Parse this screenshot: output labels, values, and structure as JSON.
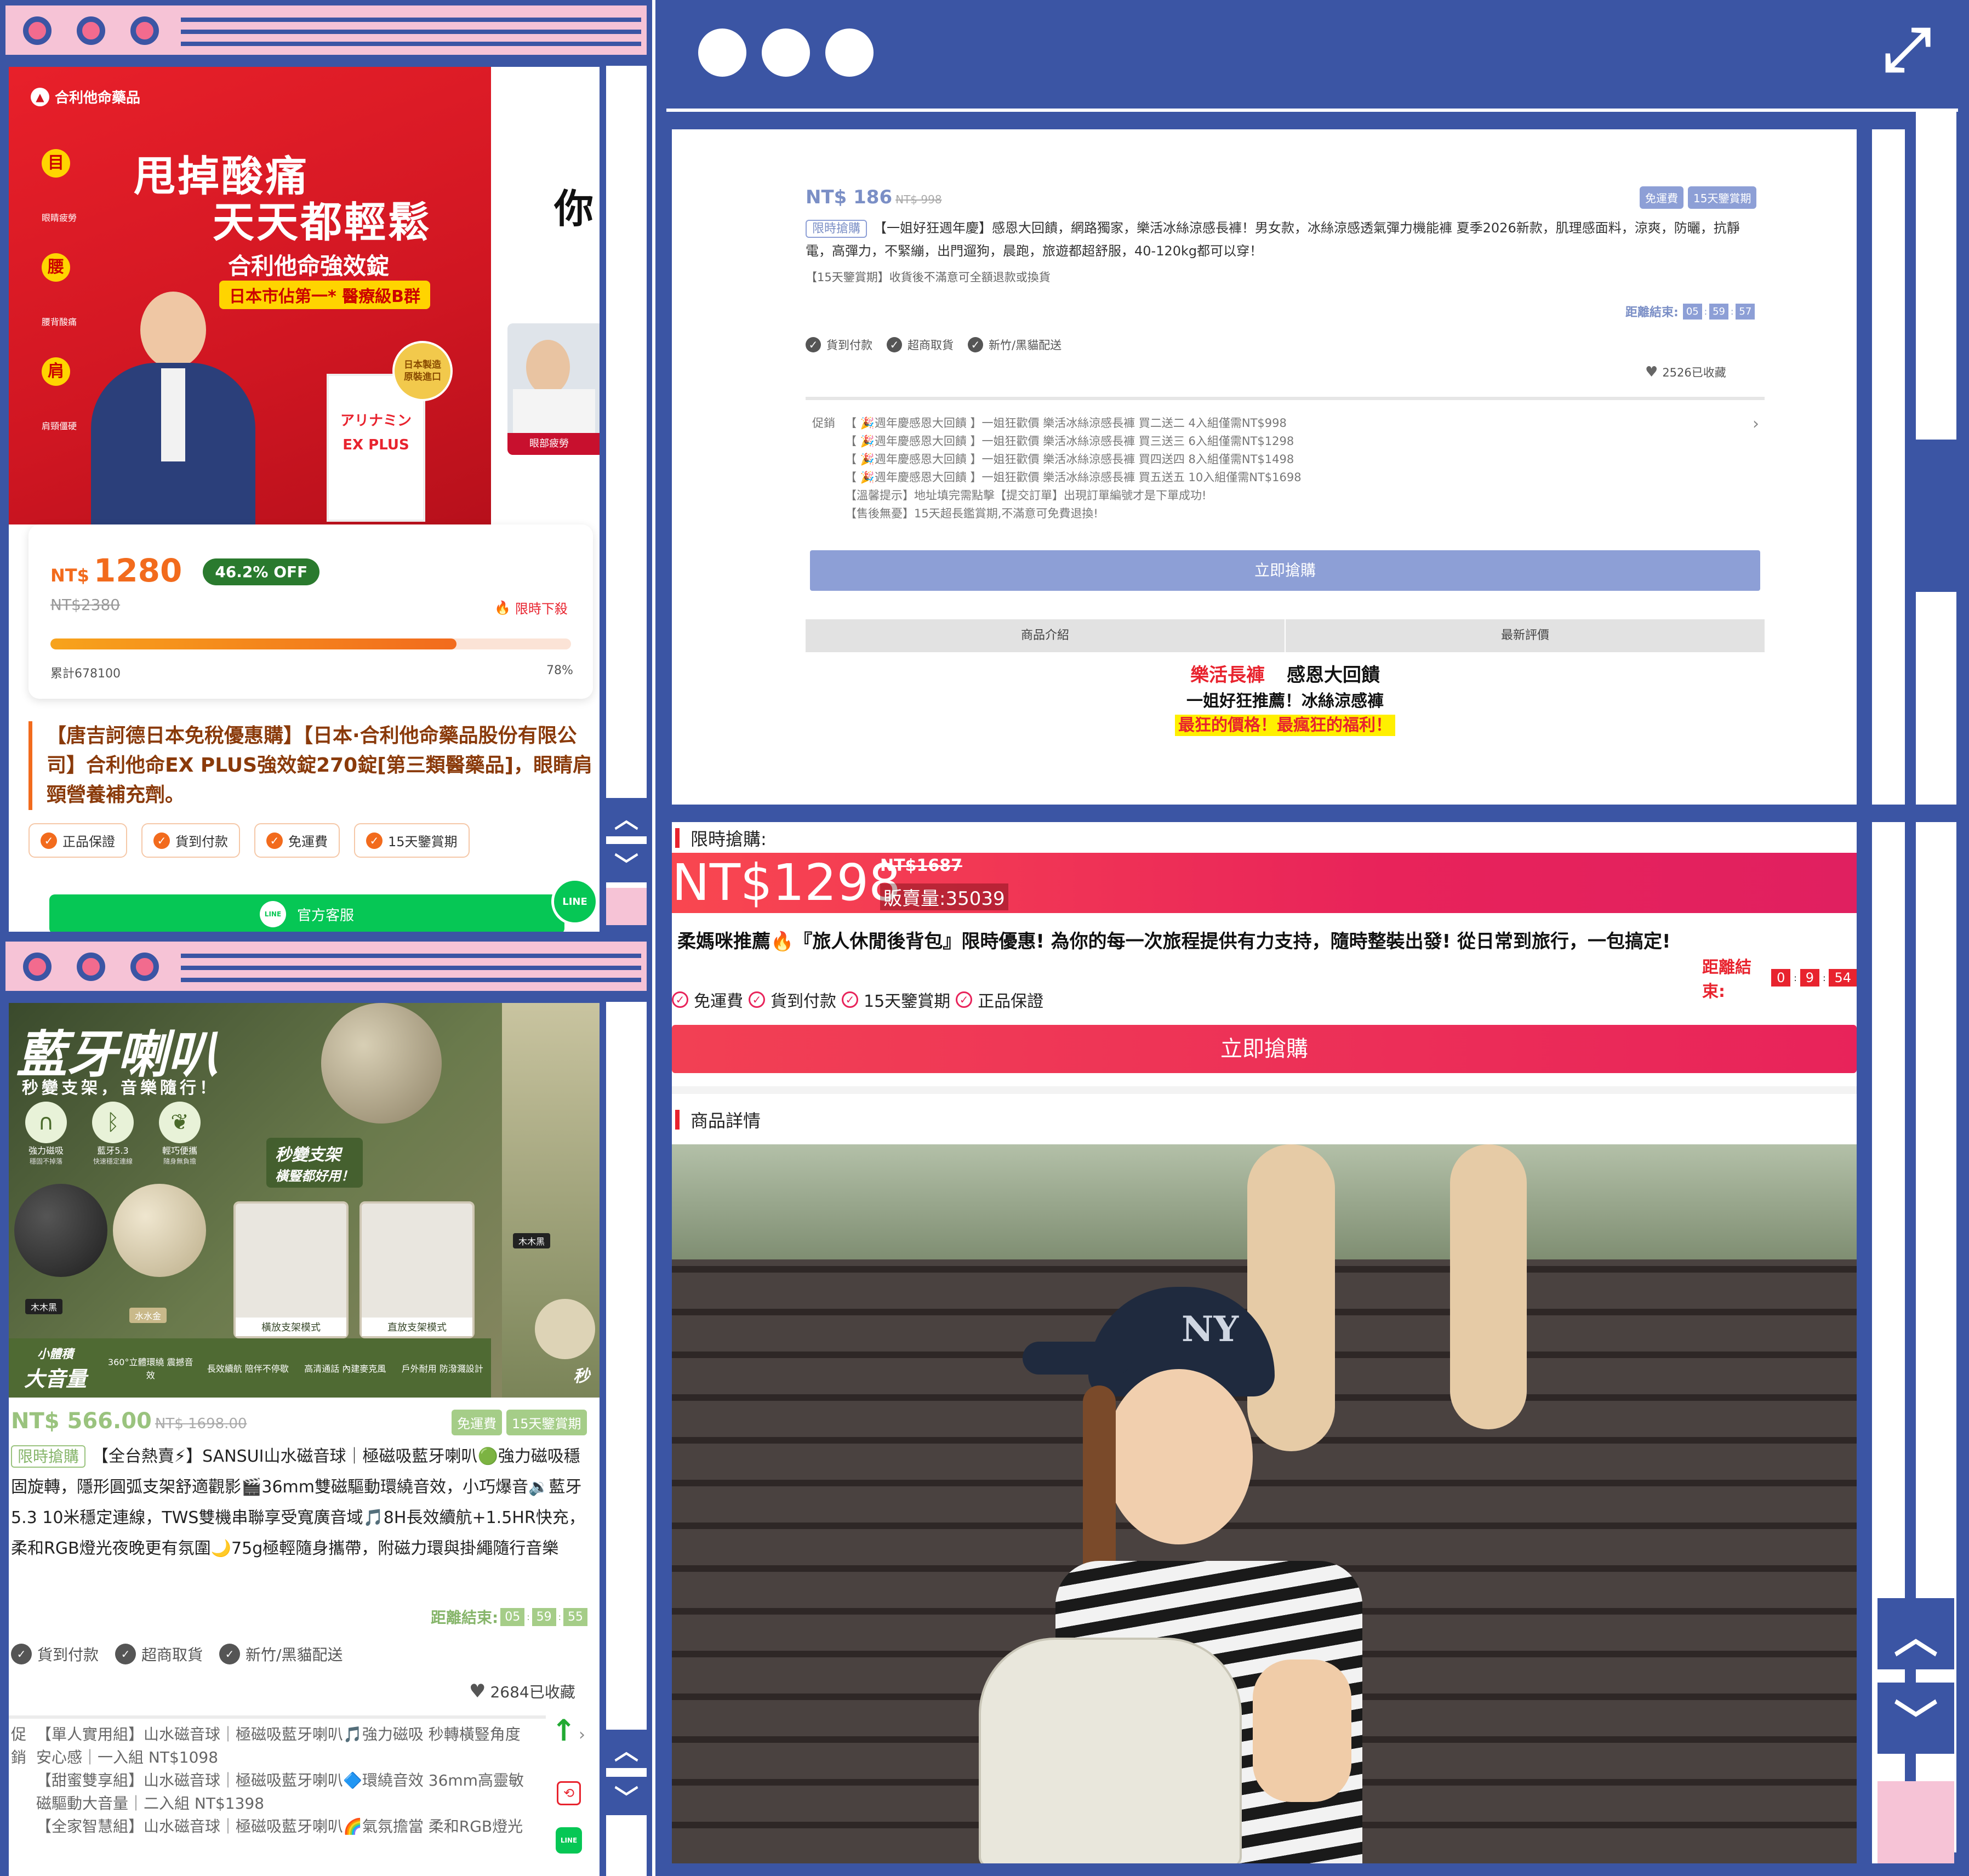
{
  "colors": {
    "frame_blue": "#3b55a4",
    "frame_pink": "#f6c3d6",
    "red": "#e8232e",
    "orange": "#f26b1d",
    "green_badge": "#2a7a2e",
    "line_green": "#06c755"
  },
  "win1": {
    "brand": "合利他命藥品",
    "banner_headline_1": "甩掉酸痛",
    "banner_headline_2": "天天都輕鬆",
    "banner_product": "合利他命強效錠",
    "banner_tagline": "日本市佔第一* 醫療級B群",
    "banner_side_labels": [
      "目",
      "腰",
      "肩"
    ],
    "banner_side_captions": [
      "眼睛疲勞",
      "腰背酸痛",
      "肩頸僵硬"
    ],
    "banner_seal": "日本製造 原裝進口",
    "box_text": "アリナミン EX PLUS",
    "partial_heading": "你",
    "side_thumb_caption": "眼部疲勞",
    "currency": "NT$",
    "price": "1280",
    "discount": "46.2% OFF",
    "original_price": "NT$2380",
    "limited_tag": "限時下殺",
    "progress_value": 0.78,
    "sold_total": "累計678100",
    "progress_pct": "78%",
    "title": "【唐吉訶德日本免稅優惠購】【日本·合利他命藥品股份有限公司】合利他命EX PLUS強效錠270錠[第三類醫藥品]，眼睛肩頸營養補充劑。",
    "tags": [
      "正品保證",
      "貨到付款",
      "免運費",
      "15天鑒賞期"
    ],
    "line_button": "官方客服",
    "line_logo": "LINE"
  },
  "win2": {
    "price": "NT$ 186",
    "original_price": "NT$ 998",
    "badges": [
      "免運費",
      "15天鑒賞期"
    ],
    "flash_tag": "限時搶購",
    "title": "【一姐好狂週年慶】感恩大回饋，網路獨家，樂活冰絲涼感長褲！男女款，冰絲涼感透氣彈力機能褲 夏季2026新款，肌理感面料，涼爽，防曬，抗靜電，高彈力，不緊繃，出門遛狗，晨跑，旅遊都超舒服，40-120kg都可以穿！",
    "return_note": "【15天鑒賞期】收貨後不滿意可全額退款或換貨",
    "countdown_label": "距離結束:",
    "countdown": [
      "05",
      "59",
      "57"
    ],
    "services": [
      "貨到付款",
      "超商取貨",
      "新竹/黑貓配送"
    ],
    "favorites": "2526已收藏",
    "promo_label": "促銷",
    "promos": [
      "【 🎉週年慶感恩大回饋 】一姐狂歡價 樂活冰絲涼感長褲 買二送二 4入組僅需NT$998",
      "【 🎉週年慶感恩大回饋 】一姐狂歡價 樂活冰絲涼感長褲 買三送三 6入組僅需NT$1298",
      "【 🎉週年慶感恩大回饋 】一姐狂歡價 樂活冰絲涼感長褲 買四送四 8入組僅需NT$1498",
      "【 🎉週年慶感恩大回饋 】一姐狂歡價 樂活冰絲涼感長褲 買五送五 10入組僅需NT$1698",
      "【溫馨提示】地址填完需點擊【提交訂單】出現訂單編號才是下單成功!",
      "【售後無憂】15天超長鑑賞期,不滿意可免費退換!"
    ],
    "buy_button": "立即搶購",
    "tab_intro": "商品介紹",
    "tab_reviews": "最新評價",
    "desc_red": "樂活長褲",
    "desc_black": "感恩大回饋",
    "desc_line2": "一姐好狂推薦！冰絲涼感褲",
    "desc_line3": "最狂的價格！最瘋狂的福利！"
  },
  "win3": {
    "flash_label": "限時搶購:",
    "price": "NT$1298",
    "original_price": "NT$1687",
    "sold": "販賣量:35039",
    "title": "柔媽咪推薦🔥『旅人休閒後背包』限時優惠! 為你的每一次旅程提供有力支持，隨時整裝出發! 從日常到旅行，一包搞定!",
    "countdown_label": "距離結束:",
    "countdown": [
      "0",
      "9",
      "54"
    ],
    "services": [
      "免運費",
      "貨到付款",
      "15天鑒賞期",
      "正品保證"
    ],
    "buy_button": "立即搶購",
    "details_label": "商品詳情",
    "cap_logo": "NY"
  },
  "win4": {
    "banner_title": "藍牙喇叭",
    "banner_sub": "秒變支架，音樂隨行！",
    "features": [
      "強力磁吸",
      "藍牙5.3",
      "輕巧便攜"
    ],
    "feature_captions": [
      "穩固不掉落",
      "快速穩定連線",
      "隨身無負擔"
    ],
    "stand_callout_1": "秒變支架",
    "stand_callout_2": "橫豎都好用！",
    "color_black": "木木黑",
    "color_gold": "水水金",
    "side_color": "木木黑",
    "mode_horizontal": "橫放支架模式",
    "mode_vertical": "直放支架模式",
    "small_body": "小體積",
    "big_volume": "大音量",
    "strip": [
      "360°立體環繞 震撼音效",
      "長效續航 陪伴不停歇",
      "高清通話 內建麥克風",
      "戶外耐用 防潑濺設計"
    ],
    "side_text": "秒",
    "price": "NT$ 566.00",
    "original_price": "NT$ 1698.00",
    "badges": [
      "免運費",
      "15天鑒賞期"
    ],
    "flash_tag": "限時搶購",
    "title": "【全台熱賣⚡】SANSUI山水磁音球｜極磁吸藍牙喇叭🟢強力磁吸穩固旋轉，隱形圓弧支架舒適觀影🎬36mm雙磁驅動環繞音效，小巧爆音🔉藍牙5.3 10米穩定連線，TWS雙機串聯享受寬廣音域🎵8H長效續航+1.5HR快充，柔和RGB燈光夜晚更有氛圍🌙75g極輕隨身攜帶，附磁力環與掛繩隨行音樂",
    "countdown_label": "距離結束:",
    "countdown": [
      "05",
      "59",
      "55"
    ],
    "services": [
      "貨到付款",
      "超商取貨",
      "新竹/黑貓配送"
    ],
    "favorites": "2684已收藏",
    "promo_label_1": "促",
    "promo_label_2": "銷",
    "promos": [
      "【單人實用組】山水磁音球｜極磁吸藍牙喇叭🎵強力磁吸 秒轉橫豎角度",
      "安心感｜一入組 NT$1098",
      "【甜蜜雙享組】山水磁音球｜極磁吸藍牙喇叭🔷環繞音效 36mm高靈敏",
      "磁驅動大音量｜二入組 NT$1398",
      "【全家智慧組】山水磁音球｜極磁吸藍牙喇叭🌈氣氛擔當 柔和RGB燈光"
    ]
  }
}
